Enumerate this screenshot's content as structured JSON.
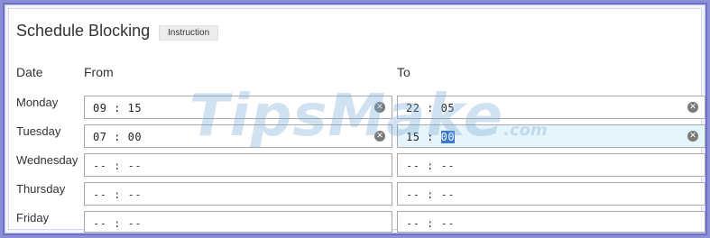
{
  "title": "Schedule Blocking",
  "instruction_button": "Instruction",
  "headers": {
    "date": "Date",
    "from": "From",
    "to": "To"
  },
  "rows": [
    {
      "day": "Monday",
      "from": "09 : 15",
      "to": "22 : 05",
      "from_clear": "✕",
      "to_clear": "✕"
    },
    {
      "day": "Tuesday",
      "from": "07 : 00",
      "to_hours": "15 : ",
      "to_minutes_selected": "00",
      "from_clear": "✕",
      "to_clear": "✕"
    },
    {
      "day": "Wednesday",
      "from": "-- : --",
      "to": "-- : --"
    },
    {
      "day": "Thursday",
      "from": "-- : --",
      "to": "-- : --"
    },
    {
      "day": "Friday",
      "from": "-- : --",
      "to": "-- : --"
    }
  ],
  "watermark": {
    "main": "TipsMake",
    "suffix": ".com"
  },
  "colors": {
    "frame": "#6d71c7",
    "selection": "#3a79d0",
    "active_field": "#e6f4fb"
  }
}
